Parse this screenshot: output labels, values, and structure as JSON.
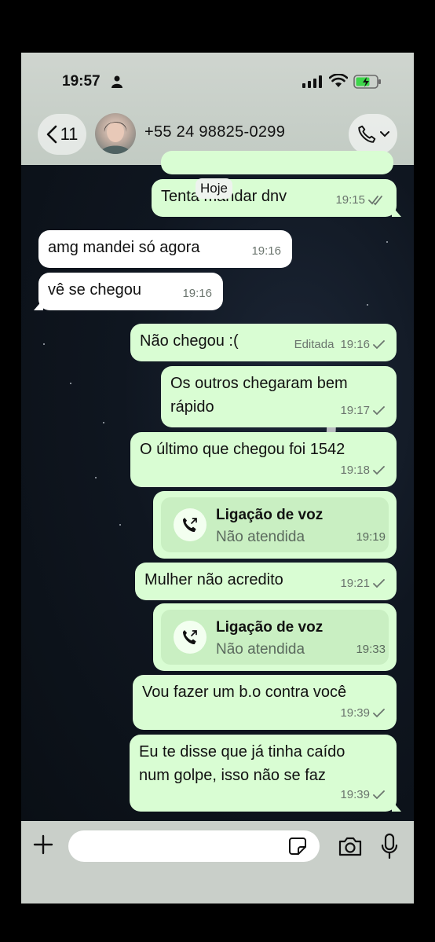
{
  "status_bar": {
    "time": "19:57"
  },
  "header": {
    "back_count": "11",
    "contact": "+55 24 98825-0299"
  },
  "date_label": "Hoje",
  "messages": [
    {
      "text": "Tenta mandar dnv",
      "time": "19:15"
    },
    {
      "text": "amg mandei só agora",
      "time": "19:16"
    },
    {
      "text": "vê se chegou",
      "time": "19:16"
    },
    {
      "text": "Não chegou :(",
      "edited": "Editada",
      "time": "19:16"
    },
    {
      "line1": "Os outros chegaram bem",
      "line2": "rápido",
      "time": "19:17"
    },
    {
      "text": "O último que chegou foi 1542",
      "time": "19:18"
    },
    {
      "title": "Ligação de voz",
      "subtitle": "Não atendida",
      "time": "19:19"
    },
    {
      "text": "Mulher não acredito",
      "time": "19:21"
    },
    {
      "title": "Ligação de voz",
      "subtitle": "Não atendida",
      "time": "19:33"
    },
    {
      "text": "Vou fazer um b.o contra você",
      "time": "19:39"
    },
    {
      "line1": "Eu te disse que já tinha caído",
      "line2": "num golpe, isso não se faz",
      "time": "19:39"
    }
  ],
  "colors": {
    "outgoing": "#d9fdd3",
    "incoming": "#ffffff",
    "header": "#c7cfc8"
  },
  "icons": [
    "person-icon",
    "signal-icon",
    "wifi-icon",
    "battery-icon",
    "chevron-left-icon",
    "phone-icon",
    "chevron-down-icon",
    "plus-icon",
    "sticker-icon",
    "camera-icon",
    "mic-icon",
    "double-check-icon",
    "check-icon",
    "missed-call-icon"
  ]
}
